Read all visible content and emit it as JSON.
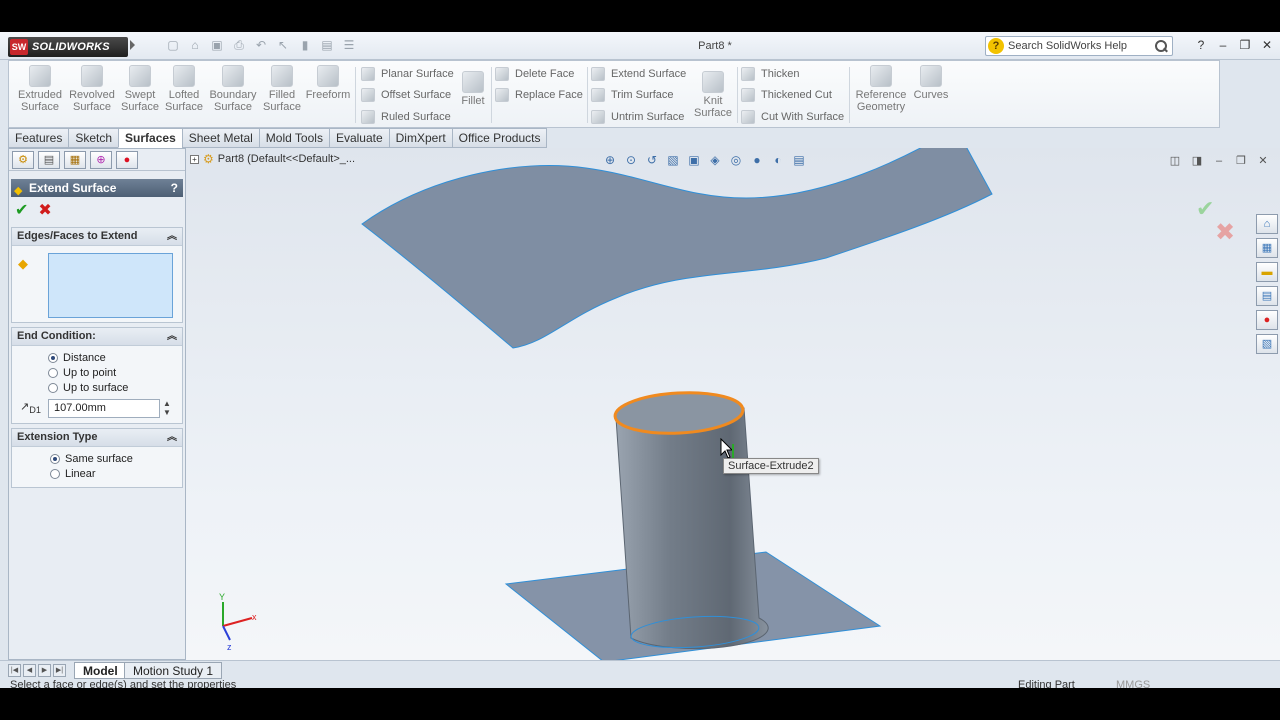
{
  "app": {
    "logo_badge": "SW",
    "logo_text": "SOLIDWORKS",
    "doc_title": "Part8 *"
  },
  "search": {
    "placeholder": "Search SolidWorks Help"
  },
  "ribbon": {
    "big_buttons": [
      {
        "l1": "Extruded",
        "l2": "Surface"
      },
      {
        "l1": "Revolved",
        "l2": "Surface"
      },
      {
        "l1": "Swept",
        "l2": "Surface"
      },
      {
        "l1": "Lofted",
        "l2": "Surface"
      },
      {
        "l1": "Boundary",
        "l2": "Surface"
      },
      {
        "l1": "Filled",
        "l2": "Surface"
      },
      {
        "l1": "Freeform",
        "l2": ""
      }
    ],
    "planar": "Planar Surface",
    "offset": "Offset Surface",
    "ruled": "Ruled Surface",
    "fillet": "Fillet",
    "delete_face": "Delete Face",
    "replace_face": "Replace Face",
    "extend_surface": "Extend Surface",
    "trim_surface": "Trim Surface",
    "untrim_surface": "Untrim Surface",
    "knit_l1": "Knit",
    "knit_l2": "Surface",
    "thicken": "Thicken",
    "thickened_cut": "Thickened Cut",
    "cut_with_surface": "Cut With Surface",
    "ref_geom_l1": "Reference",
    "ref_geom_l2": "Geometry",
    "curves": "Curves"
  },
  "tabs": [
    "Features",
    "Sketch",
    "Surfaces",
    "Sheet Metal",
    "Mold Tools",
    "Evaluate",
    "DimXpert",
    "Office Products"
  ],
  "active_tab": "Surfaces",
  "property_manager": {
    "title": "Extend Surface",
    "help": "?",
    "edges_group": "Edges/Faces to Extend",
    "end_condition_group": "End Condition:",
    "end_options": [
      "Distance",
      "Up to point",
      "Up to surface"
    ],
    "end_selected": "Distance",
    "distance_value": "107.00mm",
    "distance_label": "D1",
    "ext_type_group": "Extension Type",
    "ext_options": [
      "Same surface",
      "Linear"
    ],
    "ext_selected": "Same surface"
  },
  "tree": {
    "label": "Part8  (Default<<Default>_..."
  },
  "tooltip": "Surface-Extrude2",
  "bottom_tabs": [
    "Model",
    "Motion Study 1"
  ],
  "status": {
    "hint": "Select a face or edge(s) and set the properties",
    "mode": "Editing Part",
    "units": "MMGS"
  },
  "colors": {
    "surface": "#7f8ea3",
    "edge": "#2f8fd8",
    "selected_edge": "#f08a1f",
    "title_bar": "#e3e9f1"
  }
}
